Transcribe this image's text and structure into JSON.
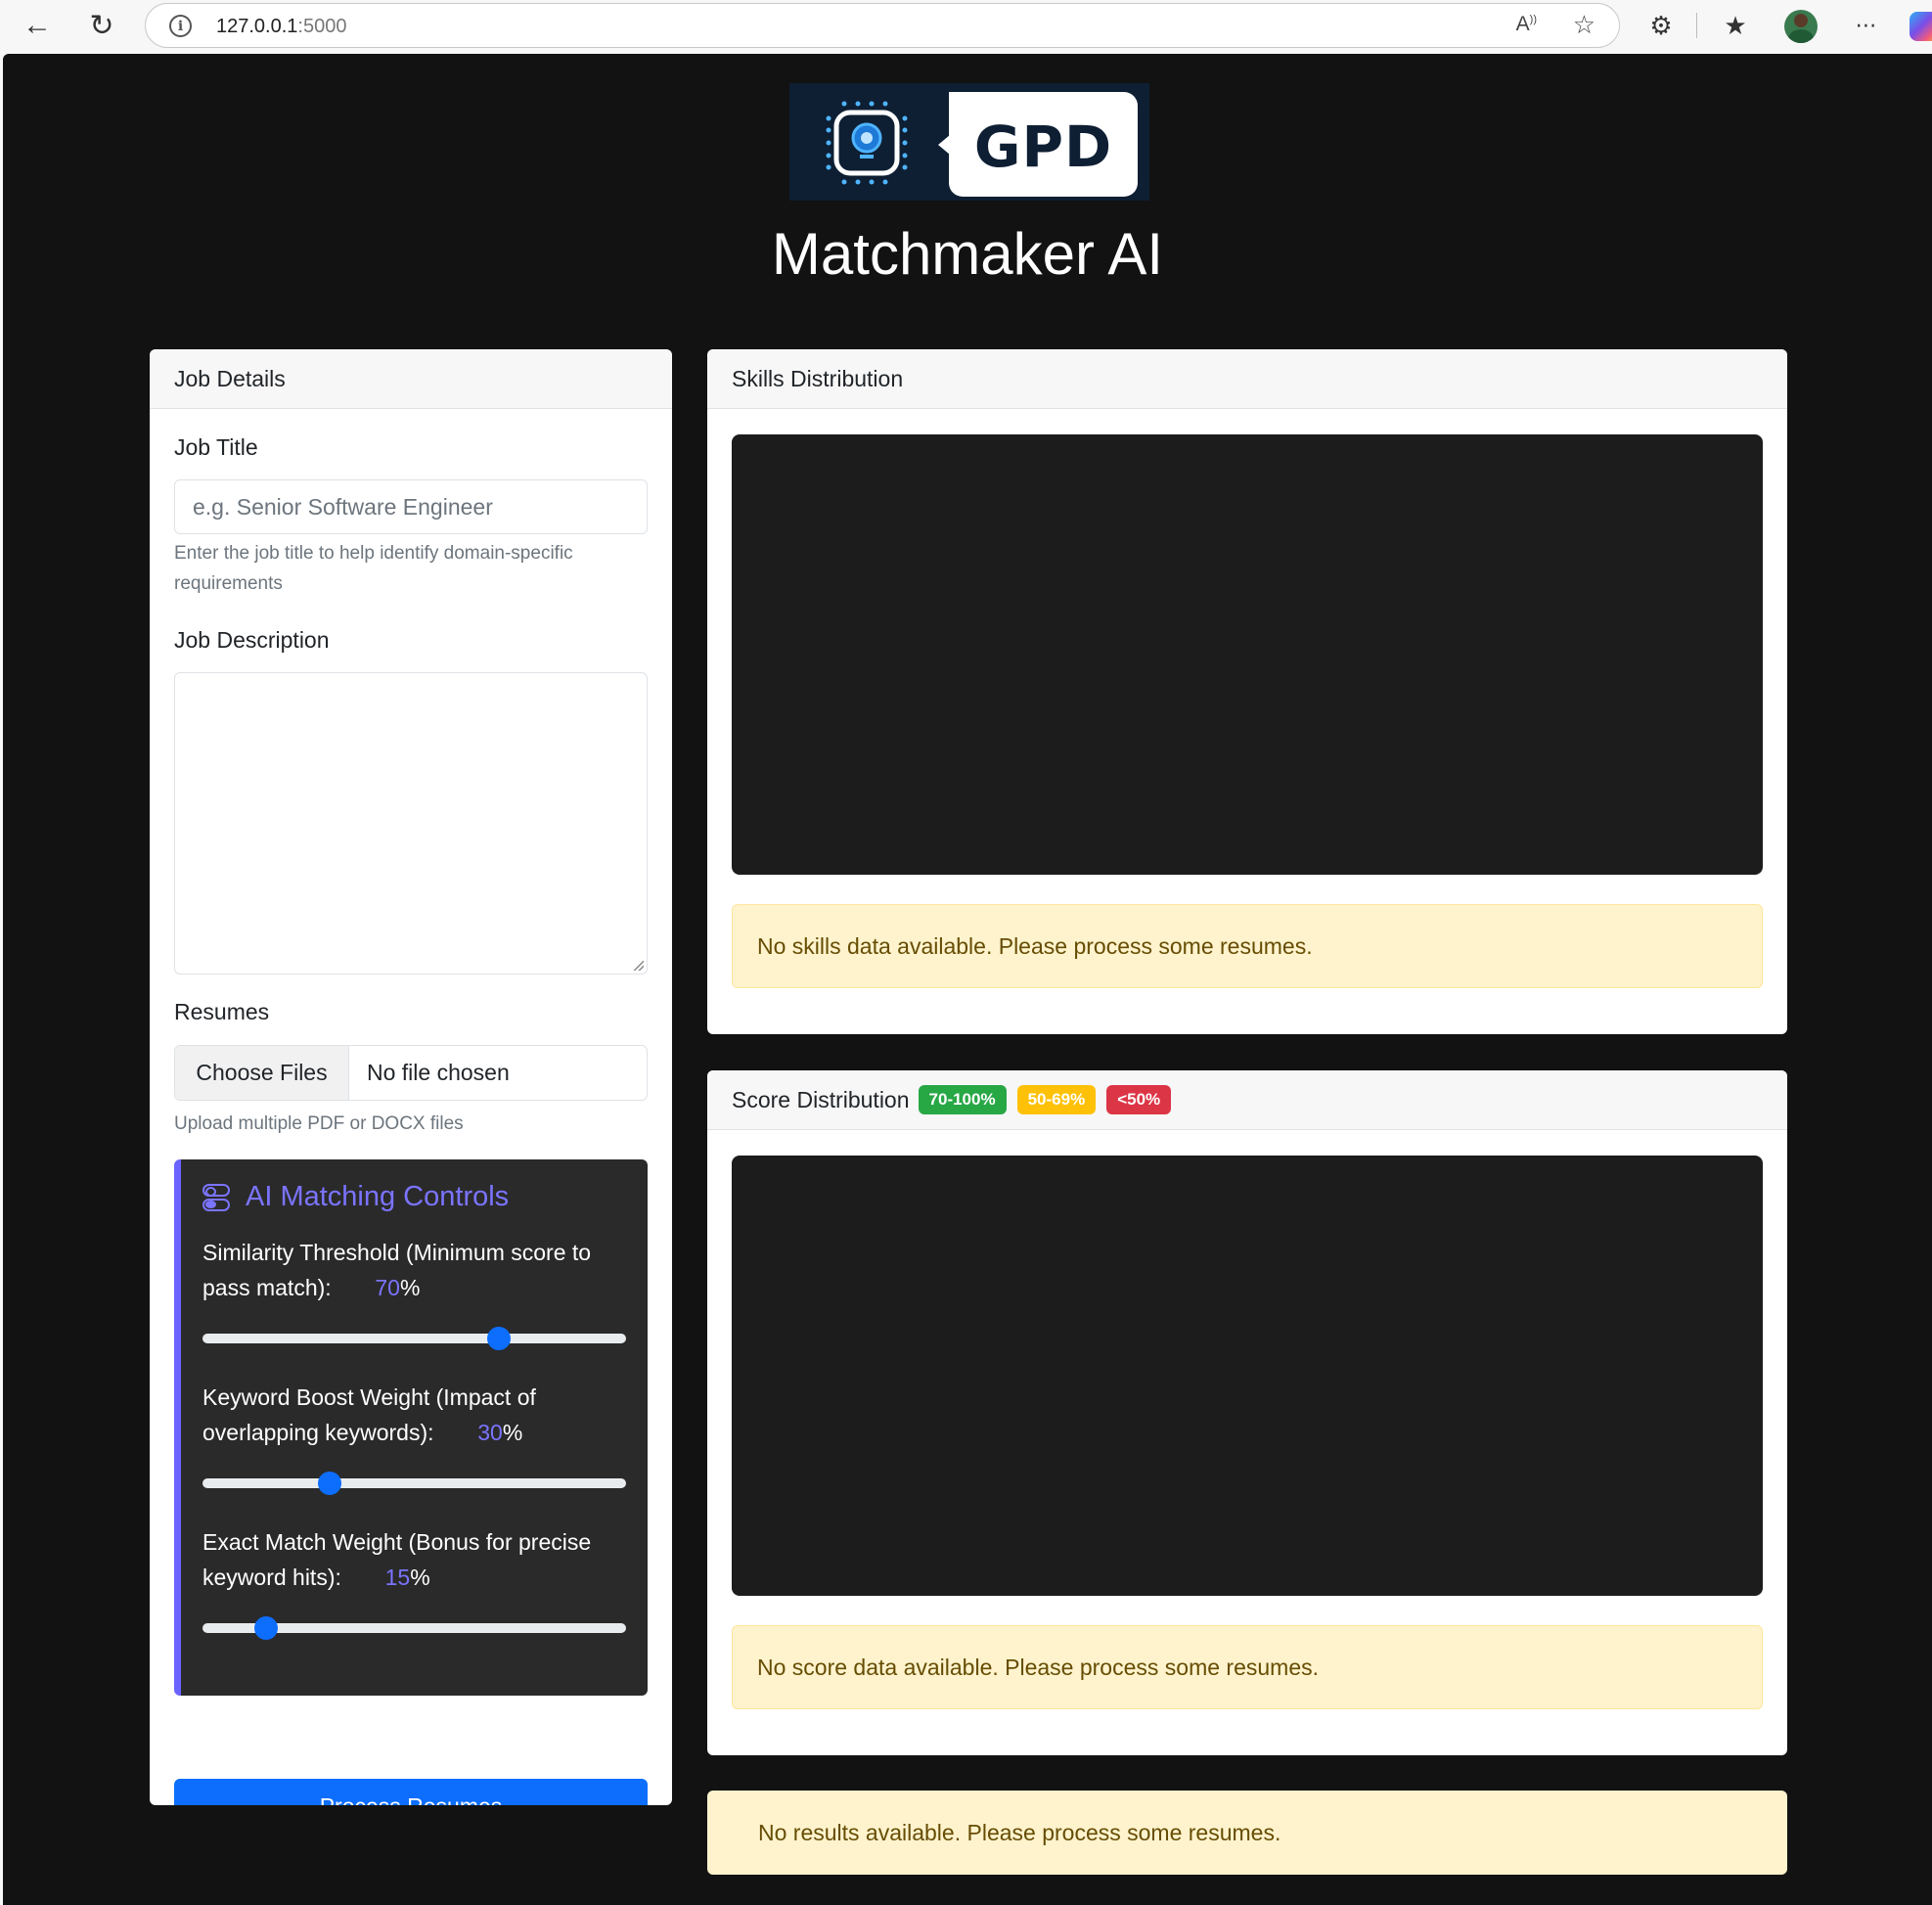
{
  "browser": {
    "url_host": "127.0.0.1",
    "url_port": ":5000",
    "icons": [
      "back-arrow-icon",
      "refresh-icon",
      "info-icon",
      "read-aloud-icon",
      "favorite-star-icon",
      "extensions-icon",
      "favorites-icon",
      "profile-avatar",
      "more-icon",
      "copilot-icon"
    ]
  },
  "header": {
    "logo_text": "GPD",
    "title": "Matchmaker AI"
  },
  "job_details": {
    "header": "Job Details",
    "job_title_label": "Job Title",
    "job_title_placeholder": "e.g. Senior Software Engineer",
    "job_title_help": "Enter the job title to help identify domain-specific requirements",
    "job_description_label": "Job Description",
    "job_description_value": "",
    "resumes_label": "Resumes",
    "choose_files_label": "Choose Files",
    "file_status": "No file chosen",
    "resumes_help": "Upload multiple PDF or DOCX files",
    "process_button": "Process Resumes"
  },
  "ai_controls": {
    "title": "AI Matching Controls",
    "similarity": {
      "label": "Similarity Threshold (Minimum score to pass match):",
      "value": "70",
      "unit": "%",
      "level": 0.7
    },
    "keyword": {
      "label": "Keyword Boost Weight (Impact of overlapping keywords):",
      "value": "30",
      "unit": "%",
      "level": 0.3
    },
    "exact": {
      "label": "Exact Match Weight (Bonus for precise keyword hits):",
      "value": "15",
      "unit": "%",
      "level": 0.15
    }
  },
  "skills_distribution": {
    "header": "Skills Distribution",
    "empty_message": "No skills data available. Please process some resumes."
  },
  "score_distribution": {
    "header": "Score Distribution",
    "badges": [
      {
        "label": "70-100%",
        "color": "#28a745"
      },
      {
        "label": "50-69%",
        "color": "#ffc107"
      },
      {
        "label": "<50%",
        "color": "#dc3545"
      }
    ],
    "empty_message": "No score data available. Please process some resumes."
  },
  "results": {
    "empty_message": "No results available. Please process some resumes."
  },
  "colors": {
    "accent": "#6b63ff",
    "primary": "#0d6efd",
    "page_bg": "#121212",
    "alert_bg": "#fff3cd"
  }
}
